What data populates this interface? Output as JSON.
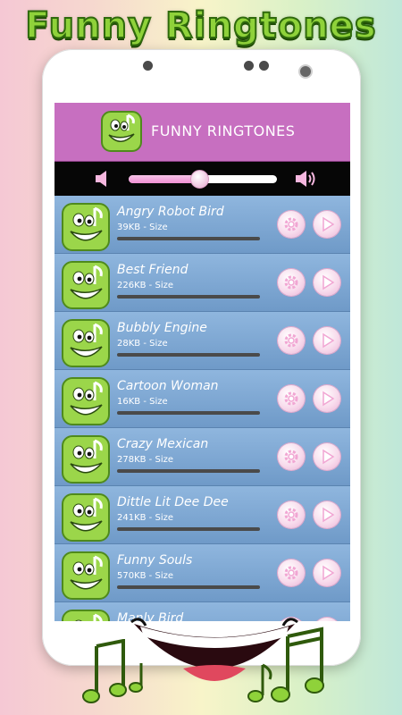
{
  "promo": {
    "title": "Funny Ringtones"
  },
  "header": {
    "title": "FUNNY RINGTONES",
    "logo_icon": "smiley-note-icon"
  },
  "volume": {
    "level": 0.47,
    "mute_icon": "speaker-low-icon",
    "max_icon": "speaker-high-icon"
  },
  "colors": {
    "accent_pink": "#f08fd4",
    "header_purple": "#c76fc0",
    "list_blue": "#7ba3cf"
  },
  "ringtones": [
    {
      "name": "Angry Robot Bird",
      "size": "39KB - Size"
    },
    {
      "name": "Best Friend",
      "size": "226KB - Size"
    },
    {
      "name": "Bubbly Engine",
      "size": "28KB - Size"
    },
    {
      "name": "Cartoon Woman",
      "size": "16KB - Size"
    },
    {
      "name": "Crazy Mexican",
      "size": "278KB - Size"
    },
    {
      "name": "Dittle Lit Dee Dee",
      "size": "241KB - Size"
    },
    {
      "name": "Funny Souls",
      "size": "570KB - Size"
    },
    {
      "name": "Manly Bird",
      "size": ""
    }
  ]
}
